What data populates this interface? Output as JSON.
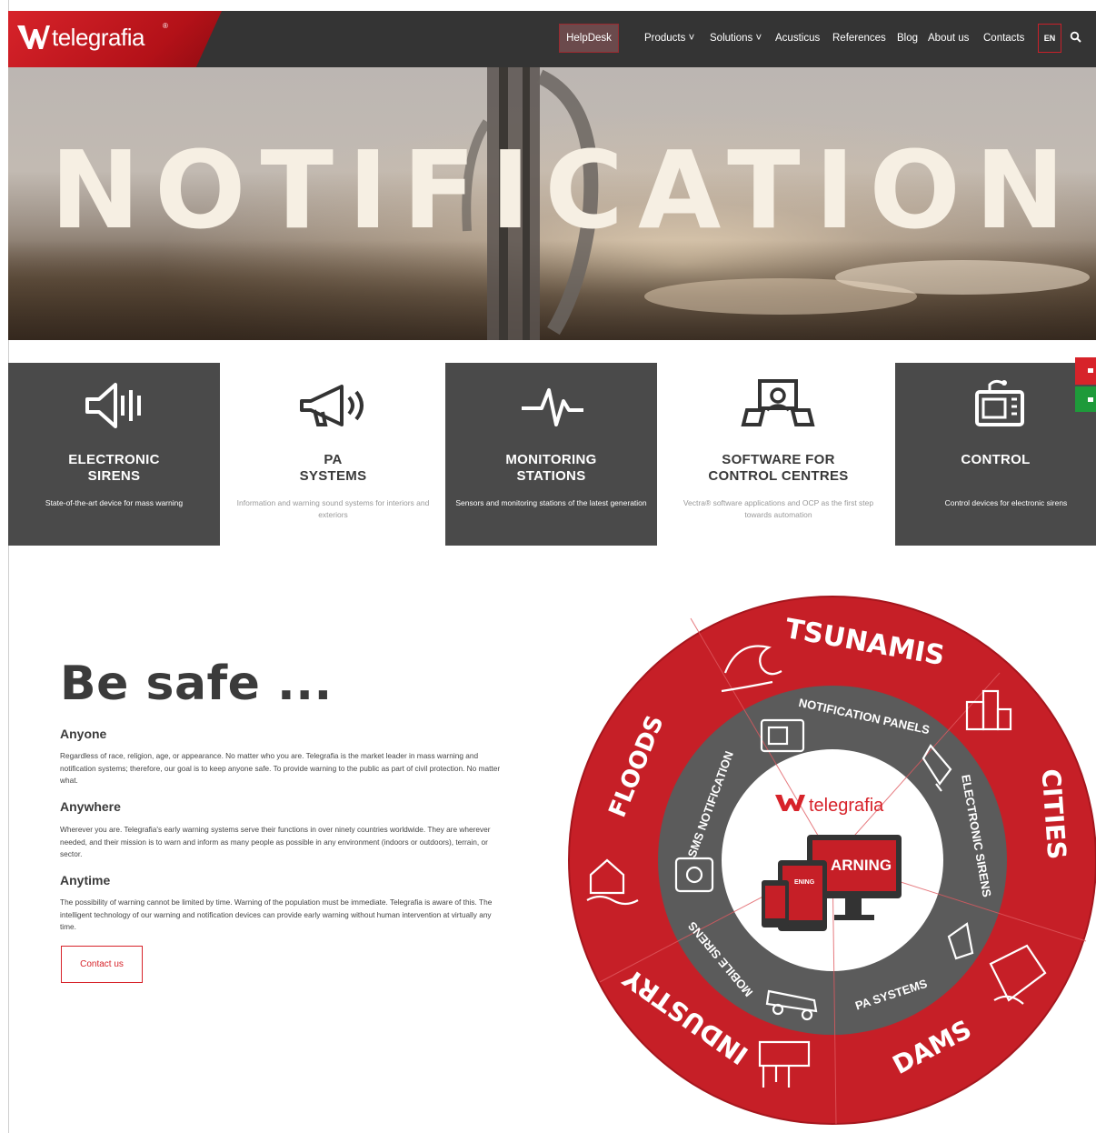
{
  "header": {
    "logo_text": "telegrafia",
    "logo_reg": "®",
    "nav": {
      "helpdesk": "HelpDesk",
      "items": [
        "Products",
        "Solutions",
        "Acusticus",
        "References",
        "Blog",
        "About us",
        "Contacts"
      ],
      "lang": "EN"
    }
  },
  "hero": {
    "title": "NOTIFICATION"
  },
  "tiles": [
    {
      "line1": "ELECTRONIC",
      "line2": "SIRENS",
      "desc": "State-of-the-art device for mass warning",
      "style": "dark",
      "icon": "siren-speaker-icon"
    },
    {
      "line1": "PA",
      "line2": "SYSTEMS",
      "desc": "Information and warning sound systems for interiors and exteriors",
      "style": "light",
      "icon": "megaphone-icon"
    },
    {
      "line1": "MONITORING",
      "line2": "STATIONS",
      "desc": "Sensors and monitoring stations of the latest generation",
      "style": "dark",
      "icon": "pulse-icon"
    },
    {
      "line1": "SOFTWARE FOR",
      "line2": "CONTROL CENTRES",
      "desc": "Vectra® software applications and OCP as the first step towards automation",
      "style": "light",
      "icon": "operator-desk-icon"
    },
    {
      "line1": "CONTROL",
      "line2": "",
      "desc": "Control devices for electronic sirens",
      "style": "dark",
      "icon": "control-panel-icon"
    }
  ],
  "content": {
    "heading": "Be safe ...",
    "sections": [
      {
        "title": "Anyone",
        "text": "Regardless of race, religion, age, or appearance. No matter who you are. Telegrafia is the market leader in mass warning and notification systems; therefore, our goal is to keep anyone safe. To provide warning to the public as part of civil protection. No matter what."
      },
      {
        "title": "Anywhere",
        "text": "Wherever you are. Telegrafia's early warning systems serve their functions in over ninety countries worldwide. They are wherever needed, and their mission is to warn and inform as many people as possible in any environment (indoors or outdoors), terrain, or sector."
      },
      {
        "title": "Anytime",
        "text": "The possibility of warning cannot be limited by time. Warning of the population must be immediate. Telegrafia is aware of this. The intelligent technology of our warning and notification devices can provide early warning without human intervention at virtually any time."
      }
    ],
    "contact_button": "Contact us"
  },
  "wheel": {
    "center_logo": "telegrafia",
    "center_screen_text": "ARNING",
    "center_small_text": "ENING",
    "outer": [
      "TSUNAMIS",
      "CITIES",
      "DAMS",
      "INDUSTRY",
      "FLOODS"
    ],
    "inner": [
      "NOTIFICATION PANELS",
      "ELECTRONIC SIRENS",
      "PA SYSTEMS",
      "MOBILE SIRENS",
      "SMS NOTIFICATION"
    ],
    "colors": {
      "outer": "#c61f27",
      "inner": "#5b5b5b",
      "center": "#ffffff"
    }
  },
  "colors": {
    "brand_red": "#d7232a",
    "dark_bar": "#343434",
    "tile_dark": "#4a4a4a",
    "accent_green": "#1e9a3a"
  }
}
